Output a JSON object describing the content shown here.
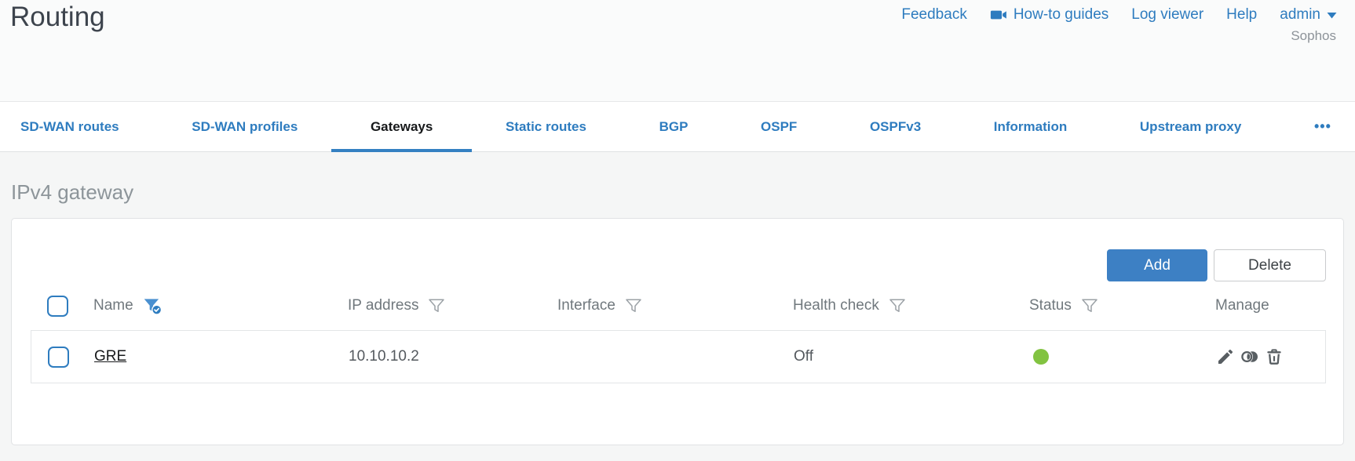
{
  "page": {
    "title": "Routing",
    "brand": "Sophos"
  },
  "top_nav": {
    "feedback": "Feedback",
    "how_to_guides": "How-to guides",
    "log_viewer": "Log viewer",
    "help": "Help",
    "user": "admin"
  },
  "tabs": {
    "items": [
      {
        "label": "SD-WAN routes",
        "active": false
      },
      {
        "label": "SD-WAN profiles",
        "active": false
      },
      {
        "label": "Gateways",
        "active": true
      },
      {
        "label": "Static routes",
        "active": false
      },
      {
        "label": "BGP",
        "active": false
      },
      {
        "label": "OSPF",
        "active": false
      },
      {
        "label": "OSPFv3",
        "active": false
      },
      {
        "label": "Information",
        "active": false
      },
      {
        "label": "Upstream proxy",
        "active": false
      }
    ],
    "more_label": "•••"
  },
  "section": {
    "heading": "IPv4 gateway"
  },
  "toolbar": {
    "add_label": "Add",
    "delete_label": "Delete"
  },
  "table": {
    "columns": [
      {
        "label": "Name",
        "filter": "active-filter-icon"
      },
      {
        "label": "IP address",
        "filter": "filter-icon"
      },
      {
        "label": "Interface",
        "filter": "filter-icon"
      },
      {
        "label": "Health check",
        "filter": "filter-icon"
      },
      {
        "label": "Status",
        "filter": "filter-icon"
      },
      {
        "label": "Manage",
        "filter": null
      }
    ],
    "rows": [
      {
        "name": "GRE",
        "ip_address": "10.10.10.2",
        "interface": "",
        "health_check": "Off",
        "status": "up-green",
        "manage_icons": [
          "edit-icon",
          "clone-icon",
          "delete-icon"
        ]
      }
    ]
  },
  "colors": {
    "accent_blue": "#2e7cbf",
    "status_green": "#82c341"
  }
}
